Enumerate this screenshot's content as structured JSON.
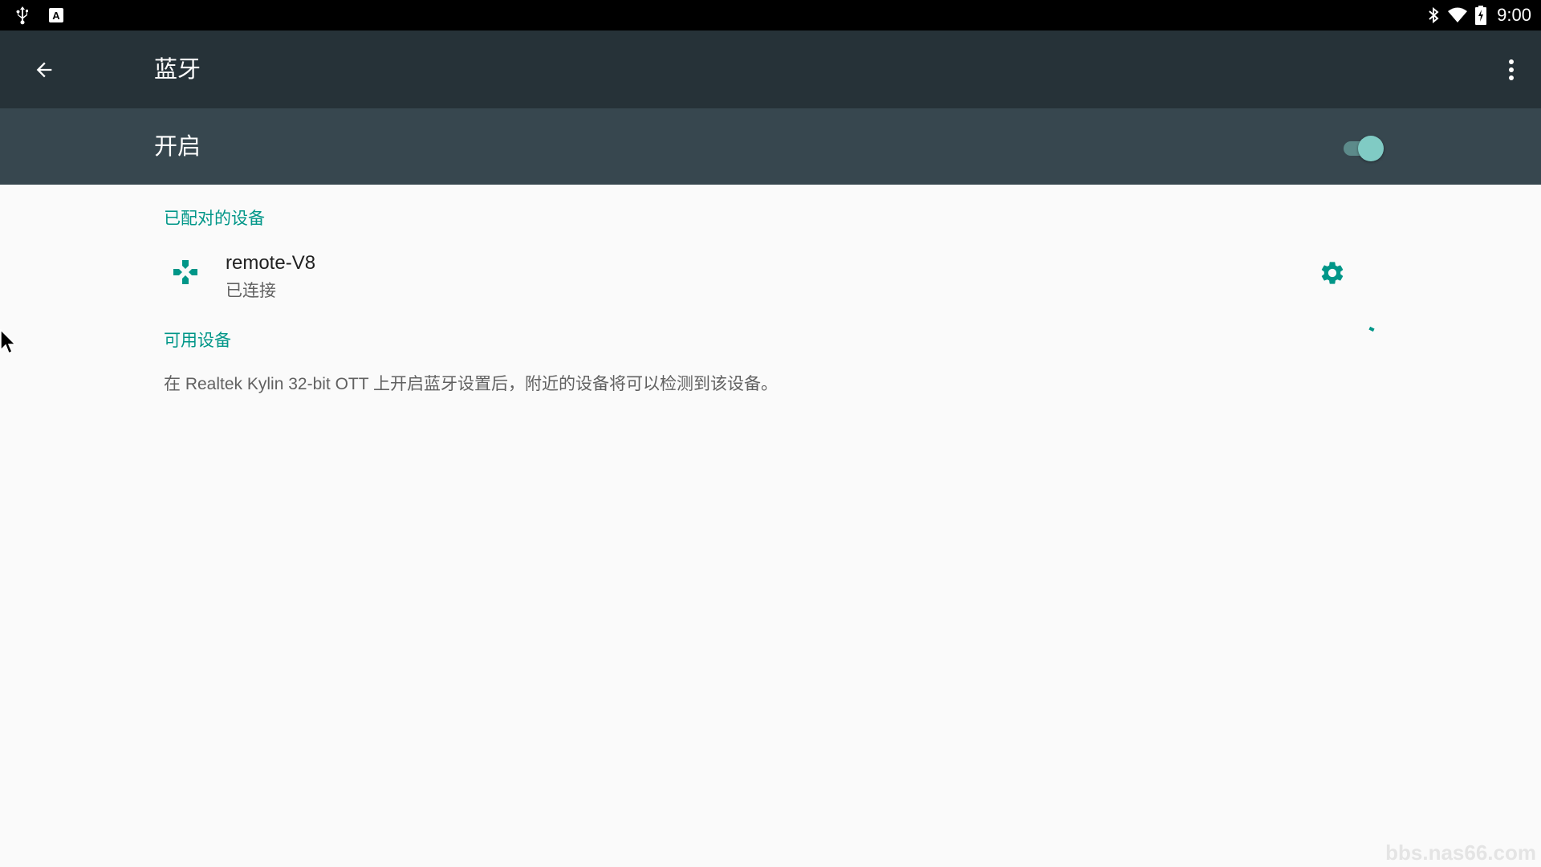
{
  "status_bar": {
    "left_icons": [
      "usb-icon",
      "keyboard-a-icon"
    ],
    "right_icons": [
      "bluetooth-icon",
      "wifi-icon",
      "battery-charging-icon"
    ],
    "time": "9:00"
  },
  "app_bar": {
    "title": "蓝牙",
    "back_icon": "arrow-back-icon",
    "menu_icon": "more-vert-icon"
  },
  "switch_bar": {
    "label": "开启",
    "enabled": true
  },
  "paired_devices": {
    "header": "已配对的设备",
    "items": [
      {
        "name": "remote-V8",
        "status": "已连接",
        "icon": "gamepad-icon",
        "settings_icon": "gear-icon"
      }
    ]
  },
  "available_devices": {
    "header": "可用设备",
    "info": "在 Realtek Kylin 32-bit OTT 上开启蓝牙设置后，附近的设备将可以检测到该设备。"
  },
  "watermark": "bbs.nas66.com",
  "colors": {
    "accent": "#009688",
    "app_bar": "#263238",
    "switch_bar": "#37474f",
    "background": "#fafafa"
  }
}
